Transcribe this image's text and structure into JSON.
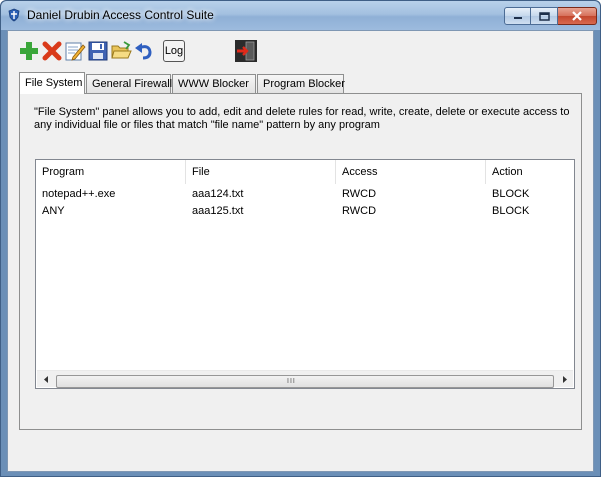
{
  "window": {
    "title": "Daniel Drubin Access Control Suite"
  },
  "toolbar": {
    "items": [
      {
        "name": "add",
        "icon": "plus-icon",
        "color": "#3aa63a"
      },
      {
        "name": "delete",
        "icon": "x-icon",
        "color": "#d93a1a"
      },
      {
        "name": "edit",
        "icon": "edit-note-icon"
      },
      {
        "name": "save",
        "icon": "floppy-disk-icon"
      },
      {
        "name": "open",
        "icon": "open-folder-icon"
      },
      {
        "name": "undo",
        "icon": "undo-arrow-icon"
      }
    ],
    "log_label": "Log",
    "exit_icon": "exit-door-icon"
  },
  "tabs": [
    {
      "label": "File System",
      "active": true
    },
    {
      "label": "General Firewall",
      "active": false
    },
    {
      "label": "WWW Blocker",
      "active": false
    },
    {
      "label": "Program Blocker",
      "active": false
    }
  ],
  "panel": {
    "description": "\"File System\" panel allows you to add, edit and delete rules for read, write, create, delete or execute access to any individual file or files that match \"file name\" pattern by any program"
  },
  "table": {
    "columns": [
      "Program",
      "File",
      "Access",
      "Action"
    ],
    "rows": [
      [
        "notepad++.exe",
        "aaa124.txt",
        "RWCD",
        "BLOCK"
      ],
      [
        "ANY",
        "aaa125.txt",
        "RWCD",
        "BLOCK"
      ]
    ]
  },
  "scrollbar": {
    "grip_label": "III"
  }
}
